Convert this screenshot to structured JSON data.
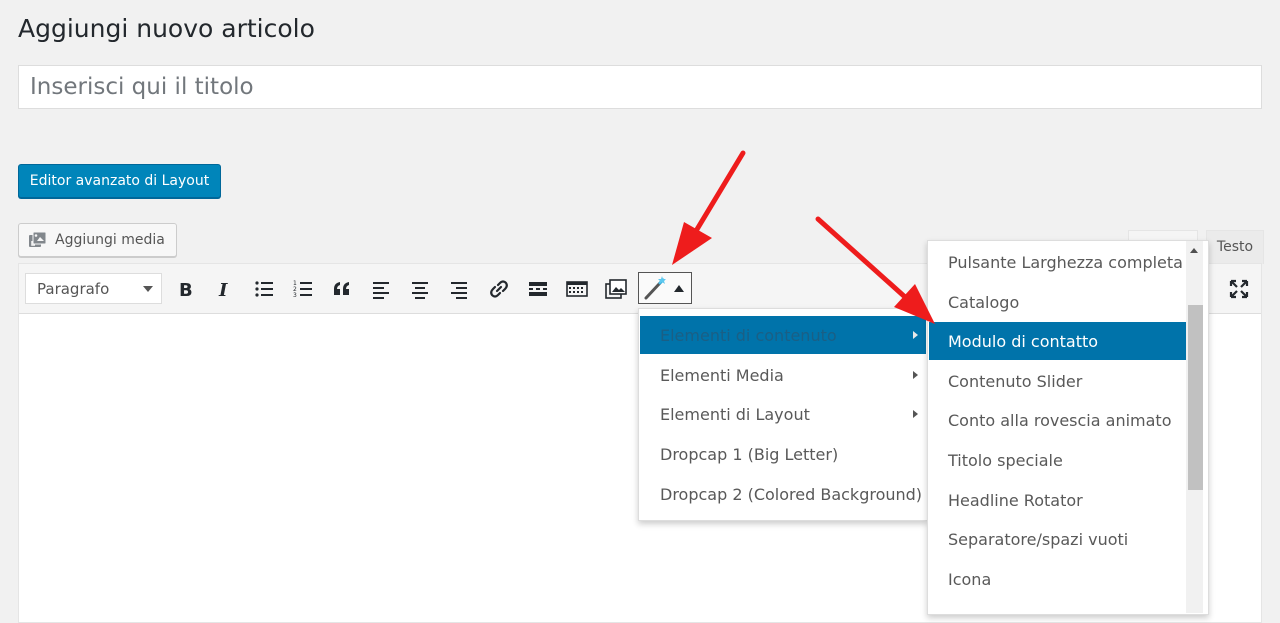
{
  "page": {
    "title": "Aggiungi nuovo articolo"
  },
  "title_field": {
    "placeholder": "Inserisci qui il titolo",
    "value": ""
  },
  "buttons": {
    "layout_editor": "Editor avanzato di Layout",
    "add_media": "Aggiungi media"
  },
  "editor_tabs": {
    "visual": "",
    "text": "Testo"
  },
  "toolbar": {
    "format_select": "Paragrafo",
    "icons": [
      "bold-icon",
      "italic-icon",
      "bulleted-list-icon",
      "numbered-list-icon",
      "blockquote-icon",
      "align-left-icon",
      "align-center-icon",
      "align-right-icon",
      "link-icon",
      "read-more-icon",
      "toolbar-toggle-icon",
      "insert-media-icon",
      "magic-wand-icon",
      "fullscreen-icon"
    ]
  },
  "shortcode_menu": {
    "items": [
      {
        "label": "Elementi di contenuto",
        "submenu": true,
        "active": true
      },
      {
        "label": "Elementi Media",
        "submenu": true
      },
      {
        "label": "Elementi di Layout",
        "submenu": true
      },
      {
        "label": "Dropcap 1 (Big Letter)",
        "submenu": false
      },
      {
        "label": "Dropcap 2 (Colored Background)",
        "submenu": false
      }
    ]
  },
  "content_submenu": {
    "items": [
      {
        "label": "Pulsante Larghezza completa"
      },
      {
        "label": "Catalogo"
      },
      {
        "label": "Modulo di contatto",
        "active": true
      },
      {
        "label": "Contenuto Slider"
      },
      {
        "label": "Conto alla rovescia animato"
      },
      {
        "label": "Titolo speciale"
      },
      {
        "label": "Headline Rotator"
      },
      {
        "label": "Separatore/spazi vuoti"
      },
      {
        "label": "Icona"
      }
    ]
  },
  "colors": {
    "primary": "#0085ba",
    "highlight": "#0073aa",
    "annotation_arrow": "#ee1c1c"
  }
}
